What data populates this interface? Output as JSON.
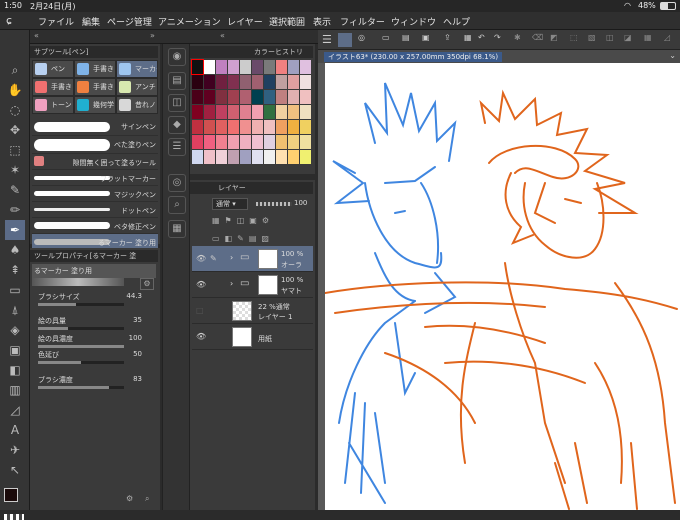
{
  "status": {
    "time": "1:50",
    "date": "2月24日(月)",
    "battery": "48%"
  },
  "menu": [
    "ファイル",
    "編集",
    "ページ管理",
    "アニメーション",
    "レイヤー",
    "選択範囲",
    "表示",
    "フィルター",
    "ウィンドウ",
    "ヘルプ"
  ],
  "subtool": {
    "header": "サブツール[ペン]",
    "tabs": [
      "ペン",
      "手書き",
      "マーカー",
      "手書きま",
      "手書き",
      "アンチ",
      "トーン",
      "幾何学",
      "昔れノ"
    ],
    "brushes": [
      "サインペン",
      "べた塗りペン",
      "隙間無く囲って塗るツール",
      "フラットマーカー",
      "マジックペン",
      "ドットペン",
      "ベタ修正ペン",
      "るマーカー 塗り用"
    ]
  },
  "properties": {
    "header": "ツールプロパティ[るマーカー 塗",
    "brush_name": "るマーカー 塗り用",
    "rows": [
      {
        "label": "ブラシサイズ",
        "value": "44.3",
        "fill": 0.44
      },
      {
        "label": "絵の具量",
        "value": "35",
        "fill": 0.35
      },
      {
        "label": "絵の具濃度",
        "value": "100",
        "fill": 1.0
      },
      {
        "label": "色延び",
        "value": "50",
        "fill": 0.5
      },
      {
        "label": "ブラシ濃度",
        "value": "83",
        "fill": 0.83
      }
    ]
  },
  "color_history": {
    "header": "カラーヒストリ"
  },
  "layers": {
    "header": "レイヤー",
    "blend": "通常",
    "opacity": "100",
    "items": [
      {
        "pct": "100 %",
        "name": "オーラ",
        "selected": true
      },
      {
        "pct": "100 %",
        "name": "ヤマト",
        "selected": false
      },
      {
        "pct": "22 %通常",
        "name": "レイヤー 1",
        "selected": false
      },
      {
        "pct": "",
        "name": "用紙",
        "selected": false
      }
    ]
  },
  "canvas": {
    "title": "イラスト63* (230.00 x 257.00mm 350dpi 68.1%)"
  },
  "colors": {
    "accent": "#5d6d88",
    "blue_line": "#3f86e0",
    "orange_line": "#e0651c"
  }
}
